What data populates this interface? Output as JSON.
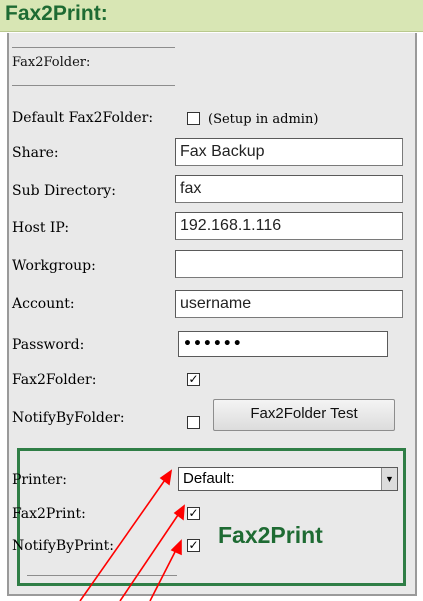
{
  "header": {
    "title": "Fax2Print:"
  },
  "fax2folder": {
    "section_title": "Fax2Folder:",
    "default_label": "Default Fax2Folder:",
    "default_checked": false,
    "default_hint": "(Setup in admin)",
    "share_label": "Share:",
    "share_value": "Fax Backup",
    "subdir_label": "Sub Directory:",
    "subdir_value": "fax",
    "hostip_label": "Host IP:",
    "hostip_value": "192.168.1.116",
    "workgroup_label": "Workgroup:",
    "workgroup_value": "",
    "account_label": "Account:",
    "account_value": "username",
    "password_label": "Password:",
    "password_mask": "••••••",
    "enable_label": "Fax2Folder:",
    "enable_checked": true,
    "notify_label": "NotifyByFolder:",
    "notify_checked": false,
    "test_button": "Fax2Folder Test"
  },
  "printer": {
    "printer_label": "Printer:",
    "printer_value": "Default:",
    "fax2print_label": "Fax2Print:",
    "fax2print_checked": true,
    "notify_label": "NotifyByPrint:",
    "notify_checked": true,
    "big_label": "Fax2Print"
  },
  "colors": {
    "header_bg": "#d8e6b4",
    "brand_green": "#1e6b33",
    "box_border": "#2f7e46",
    "arrow": "#ff0000"
  }
}
